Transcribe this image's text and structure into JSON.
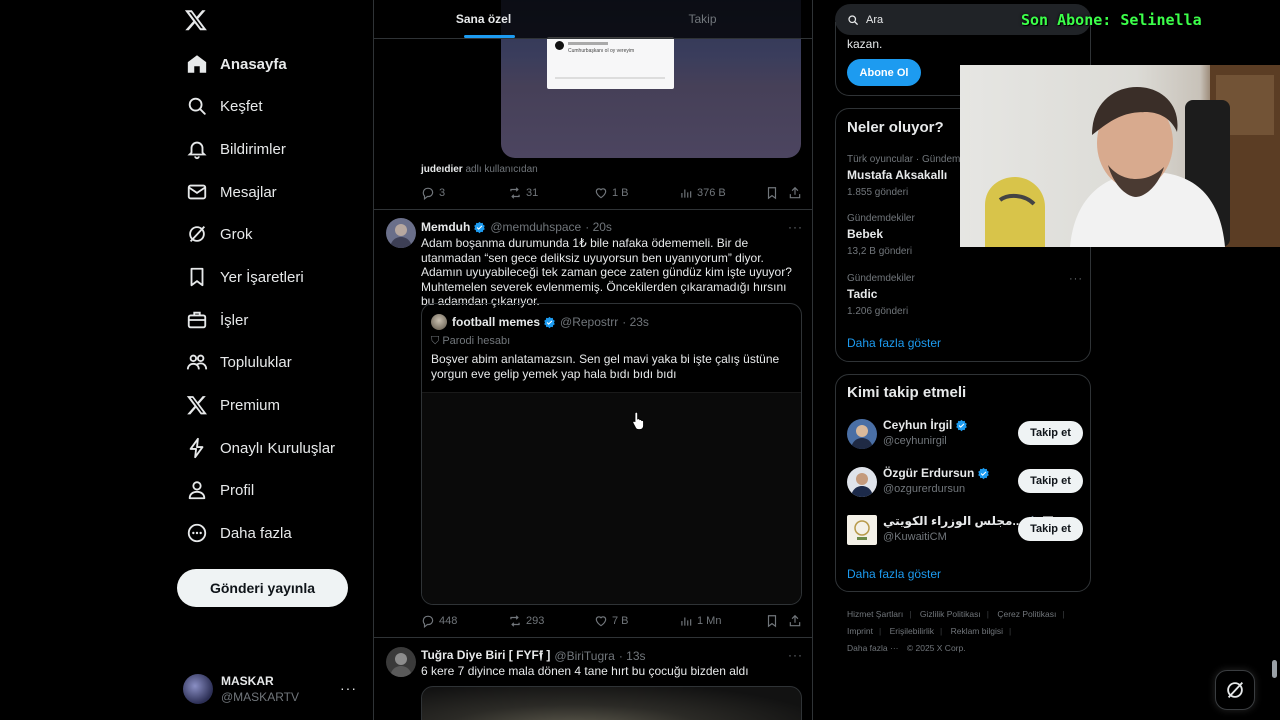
{
  "nav": {
    "items": [
      {
        "label": "Anasayfa",
        "icon": "home-icon"
      },
      {
        "label": "Keşfet",
        "icon": "search-icon"
      },
      {
        "label": "Bildirimler",
        "icon": "bell-icon"
      },
      {
        "label": "Mesajlar",
        "icon": "mail-icon"
      },
      {
        "label": "Grok",
        "icon": "grok-icon"
      },
      {
        "label": "Yer İşaretleri",
        "icon": "bookmark-icon"
      },
      {
        "label": "İşler",
        "icon": "briefcase-icon"
      },
      {
        "label": "Topluluklar",
        "icon": "people-icon"
      },
      {
        "label": "Premium",
        "icon": "x-logo-icon"
      },
      {
        "label": "Onaylı Kuruluşlar",
        "icon": "lightning-icon"
      },
      {
        "label": "Profil",
        "icon": "user-icon"
      },
      {
        "label": "Daha fazla",
        "icon": "more-circle-icon"
      }
    ],
    "post_button": "Gönderi yayınla",
    "account": {
      "name": "MASKAR",
      "handle": "@MASKARTV"
    }
  },
  "feed": {
    "tabs": [
      {
        "label": "Sana özel",
        "active": true
      },
      {
        "label": "Takip",
        "active": false
      }
    ],
    "tweet1": {
      "media_card_text": "Cumhurbaşkanı ol oy vereyim",
      "caption_user": "judeıdier",
      "caption_suffix": "adlı kullanıcıdan",
      "stats": {
        "replies": "3",
        "reposts": "31",
        "likes": "1 B",
        "views": "376 B"
      }
    },
    "tweet2": {
      "name": "Memduh",
      "handle": "@memduhspace",
      "time": "· 20s",
      "text": "Adam boşanma durumunda 1₺ bile nafaka ödememeli. Bir de utanmadan “sen gece deliksiz uyuyorsun ben uyanıyorum” diyor. Adamın uyuyabileceği tek zaman gece zaten gündüz kim işte uyuyor? Muhtemelen severek evlenmemiş. Öncekilerden çıkaramadığı hırsını bu adamdan çıkarıyor.",
      "quote": {
        "name": "football memes",
        "handle": "@Repostrr",
        "time": "· 23s",
        "label": "Parodi hesabı",
        "text": "Boşver abim anlatamazsın. Sen gel mavi yaka bi işte çalış üstüne yorgun eve gelip yemek yap hala bıdı bıdı bıdı"
      },
      "stats": {
        "replies": "448",
        "reposts": "293",
        "likes": "7 B",
        "views": "1 Mn"
      }
    },
    "tweet3": {
      "name": "Tuğra Diye Biri [ FYF𝖋 ]",
      "handle": "@BiriTugra",
      "time": "· 13s",
      "text": "6 kere 7 diyince mala dönen 4 tane hırt bu çocuğu bizden aldı"
    }
  },
  "right": {
    "search_placeholder": "Ara",
    "stream_overlay": "Son Abone: Selinella",
    "premium": {
      "text": "kazan.",
      "button": "Abone Ol"
    },
    "trends": {
      "title": "Neler oluyor?",
      "items": [
        {
          "context": "Türk oyuncular · Gündemde",
          "title": "Mustafa Aksakallı",
          "count": "1.855 gönderi"
        },
        {
          "context": "Gündemdekiler",
          "title": "Bebek",
          "count": "13,2 B gönderi"
        },
        {
          "context": "Gündemdekiler",
          "title": "Tadic",
          "count": "1.206 gönderi"
        }
      ],
      "more": "Daha fazla göster"
    },
    "who_to_follow": {
      "title": "Kimi takip etmeli",
      "users": [
        {
          "name": "Ceyhun İrgil",
          "handle": "@ceyhunirgil",
          "button": "Takip et"
        },
        {
          "name": "Özgür Erdursun",
          "handle": "@ozgurerdursun",
          "button": "Takip et"
        },
        {
          "name": "مجلس الوزراء الكويتي...",
          "handle": "@KuwaitiCM",
          "button": "Takip et"
        }
      ],
      "more": "Daha fazla göster"
    },
    "footer": {
      "links": [
        "Hizmet Şartları",
        "Gizlilik Politikası",
        "Çerez Politikası",
        "Imprint",
        "Erişilebilirlik",
        "Reklam bilgisi",
        "Daha fazla ···"
      ],
      "copyright": "© 2025 X Corp."
    }
  }
}
